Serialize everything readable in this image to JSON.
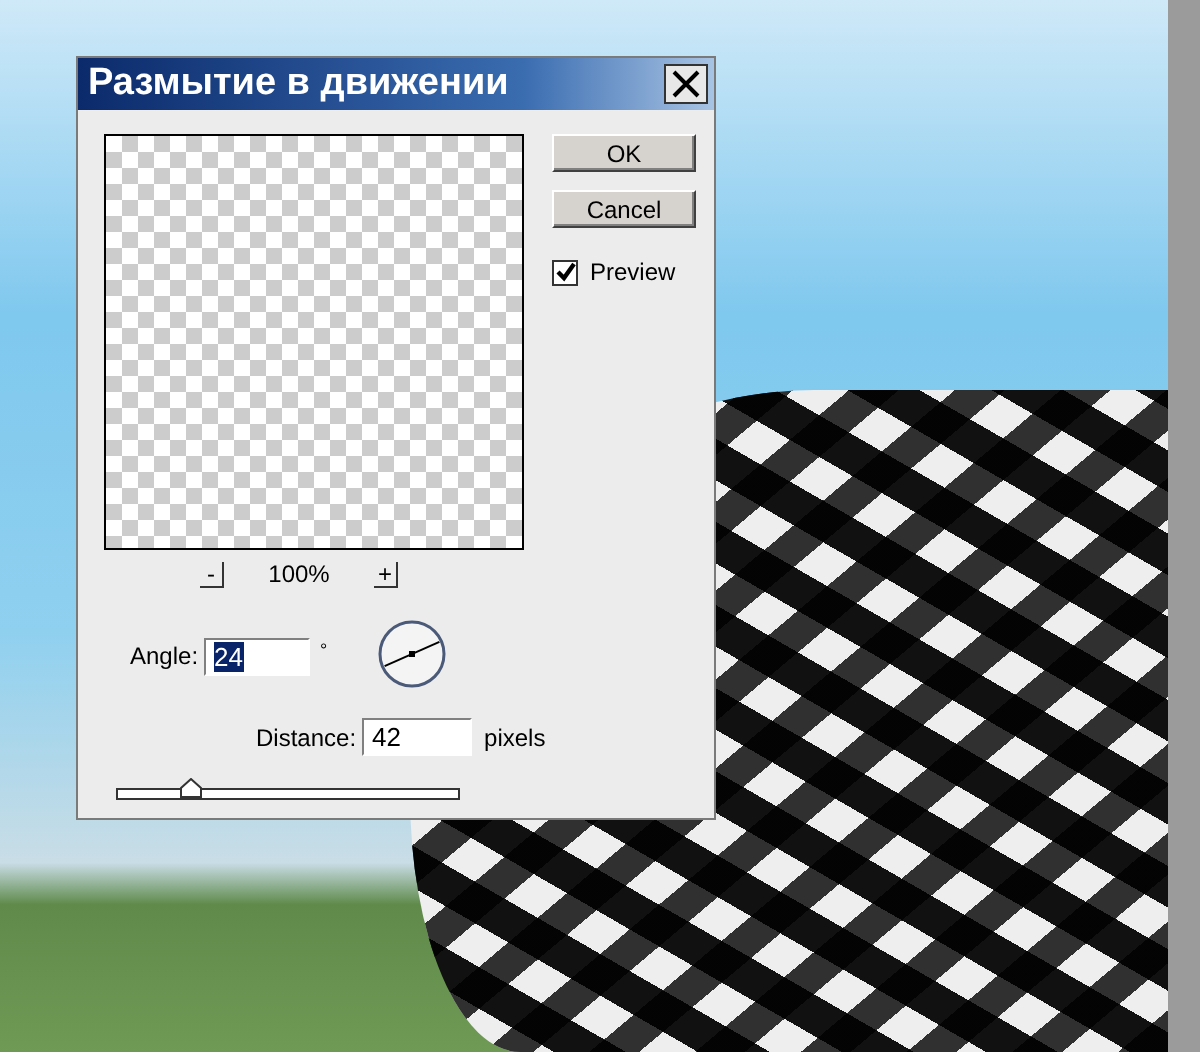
{
  "dialog": {
    "title": "Размытие в движении",
    "buttons": [
      {
        "label": "OK"
      },
      {
        "label": "Cancel"
      }
    ],
    "preview": {
      "label": "Preview",
      "checked": true
    },
    "zoom": {
      "minus": "-",
      "value": "100%",
      "plus": "+"
    },
    "angle": {
      "label": "Angle:",
      "value": "24",
      "unit": "°"
    },
    "distance": {
      "label": "Distance:",
      "value": "42",
      "unit": "pixels",
      "level": 0.22
    }
  }
}
